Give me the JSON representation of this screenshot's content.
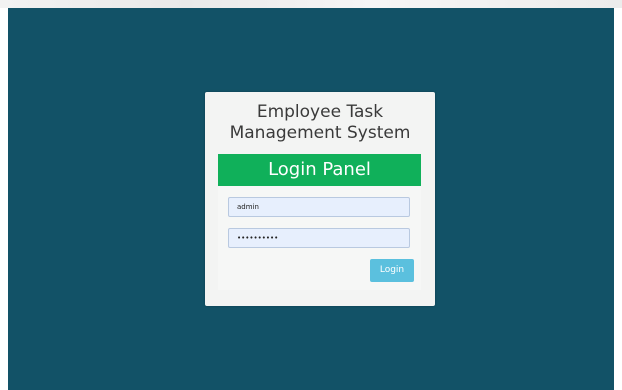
{
  "window": {
    "title_line1": "Employee Task",
    "title_line2": "Management System"
  },
  "login_panel": {
    "header": "Login Panel",
    "username_value": "admin",
    "password_masked": "••••••••••",
    "login_label": "Login"
  },
  "colors": {
    "backdrop": "#125267",
    "panel_header": "#10b05a",
    "login_button": "#5bc0de",
    "input_bg": "#e7effd"
  }
}
